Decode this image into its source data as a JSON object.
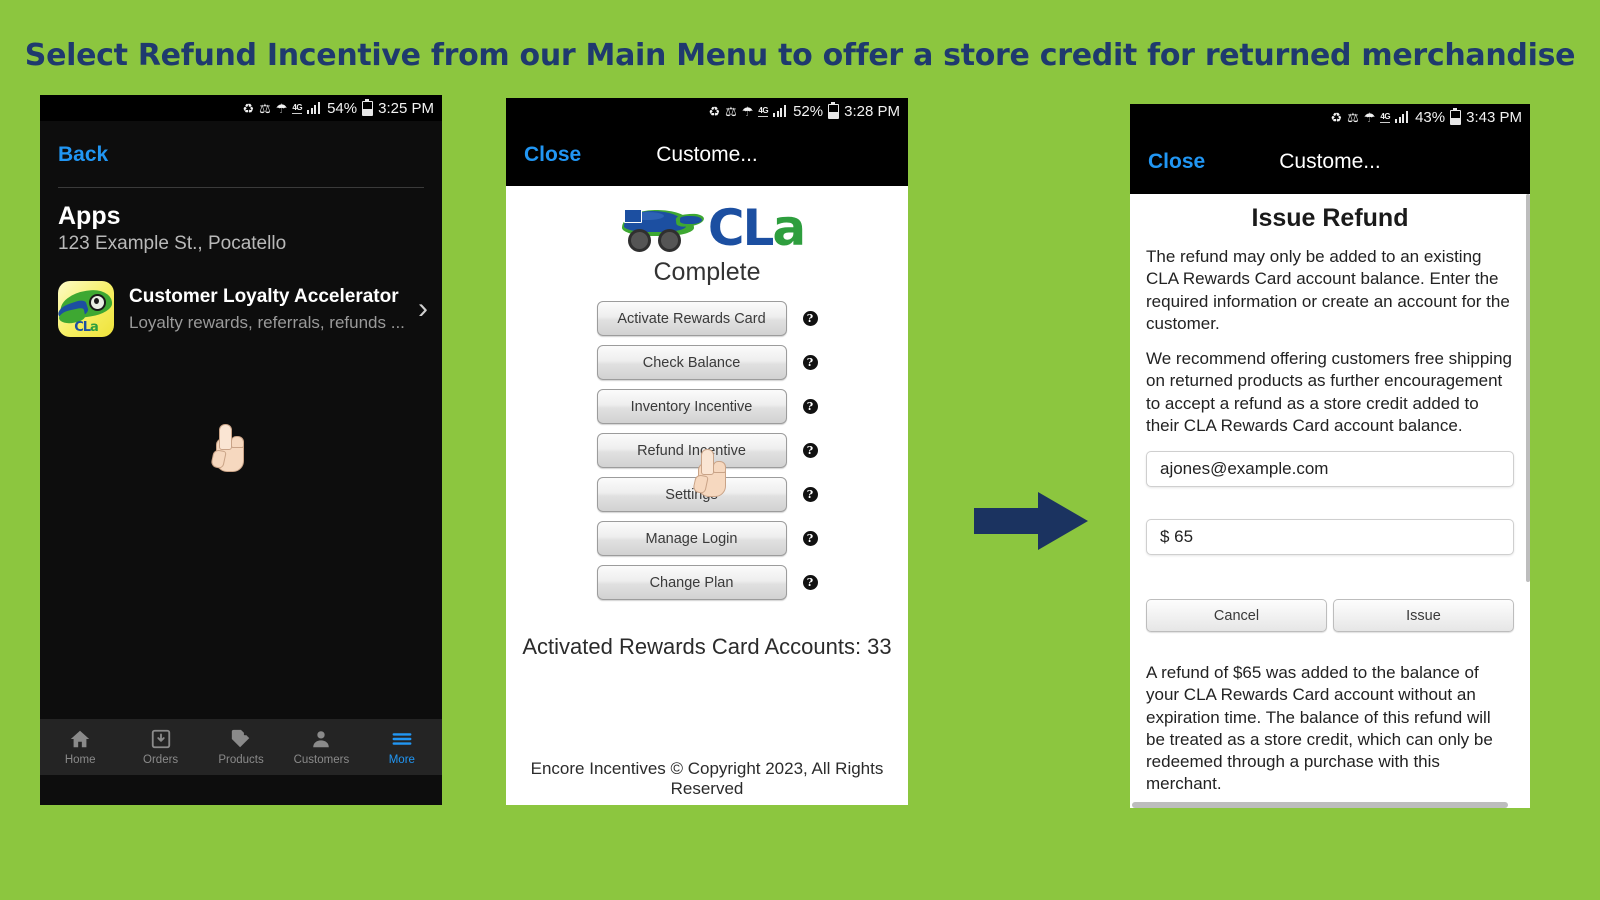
{
  "headline": "Select Refund Incentive from our Main Menu to offer a store credit for returned merchandise",
  "colors": {
    "background_green": "#8CC63F",
    "headline_navy": "#1F3A6E",
    "arrow_navy": "#1B3360",
    "link_blue": "#2196F3",
    "logo_blue": "#1C4FA1",
    "logo_green": "#2E9E3E"
  },
  "phone1": {
    "statusbar": {
      "icons": [
        "data-saver-icon",
        "bluetooth-icon",
        "wifi-icon"
      ],
      "network": "4G",
      "signal": "signal-bars-icon",
      "battery_percent": "54%",
      "battery": "battery-icon",
      "time": "3:25 PM"
    },
    "back_label": "Back",
    "section_title": "Apps",
    "section_subtitle": "123 Example St., Pocatello",
    "app": {
      "icon_name": "cla-app-icon",
      "icon_text": "CLA",
      "title": "Customer Loyalty Accelerator",
      "subtitle": "Loyalty rewards, referrals, refunds ...",
      "chevron": "›"
    },
    "nav": [
      {
        "label": "Home",
        "icon": "home-icon",
        "active": false
      },
      {
        "label": "Orders",
        "icon": "inbox-download-icon",
        "active": false
      },
      {
        "label": "Products",
        "icon": "tag-icon",
        "active": false
      },
      {
        "label": "Customers",
        "icon": "person-icon",
        "active": false
      },
      {
        "label": "More",
        "icon": "hamburger-icon",
        "active": true
      }
    ]
  },
  "phone2": {
    "statusbar": {
      "battery_percent": "52%",
      "network": "4G",
      "time": "3:28 PM"
    },
    "close_label": "Close",
    "title": "Custome...",
    "logo": {
      "name": "cla-complete-logo",
      "mark_c": "C",
      "mark_l": "L",
      "mark_a": "a",
      "wordmark": "Complete"
    },
    "menu_items": [
      {
        "label": "Activate Rewards Card",
        "help": "?"
      },
      {
        "label": "Check Balance",
        "help": "?"
      },
      {
        "label": "Inventory Incentive",
        "help": "?"
      },
      {
        "label": "Refund Incentive",
        "help": "?"
      },
      {
        "label": "Settings",
        "help": "?"
      },
      {
        "label": "Manage Login",
        "help": "?"
      },
      {
        "label": "Change Plan",
        "help": "?"
      }
    ],
    "account_count": "Activated Rewards Card Accounts: 33",
    "footer": "Encore Incentives © Copyright 2023, All Rights Reserved"
  },
  "phone3": {
    "statusbar": {
      "battery_percent": "43%",
      "network": "4G",
      "time": "3:43 PM"
    },
    "close_label": "Close",
    "title": "Custome...",
    "heading": "Issue Refund",
    "paragraph1": "The refund may only be added to an existing CLA Rewards Card account balance. Enter the required information or create an account for the customer.",
    "paragraph2": "We recommend offering customers free shipping on returned products as further encouragement to accept a refund as a store credit added to their CLA Rewards Card account balance.",
    "email_value": "ajones@example.com",
    "amount_value": "$ 65",
    "cancel_label": "Cancel",
    "issue_label": "Issue",
    "confirmation": "A refund of $65 was added to the balance of your CLA Rewards Card account without an expiration time. The balance of this refund will be treated as a store credit, which can only be redeemed through a purchase with this merchant."
  }
}
